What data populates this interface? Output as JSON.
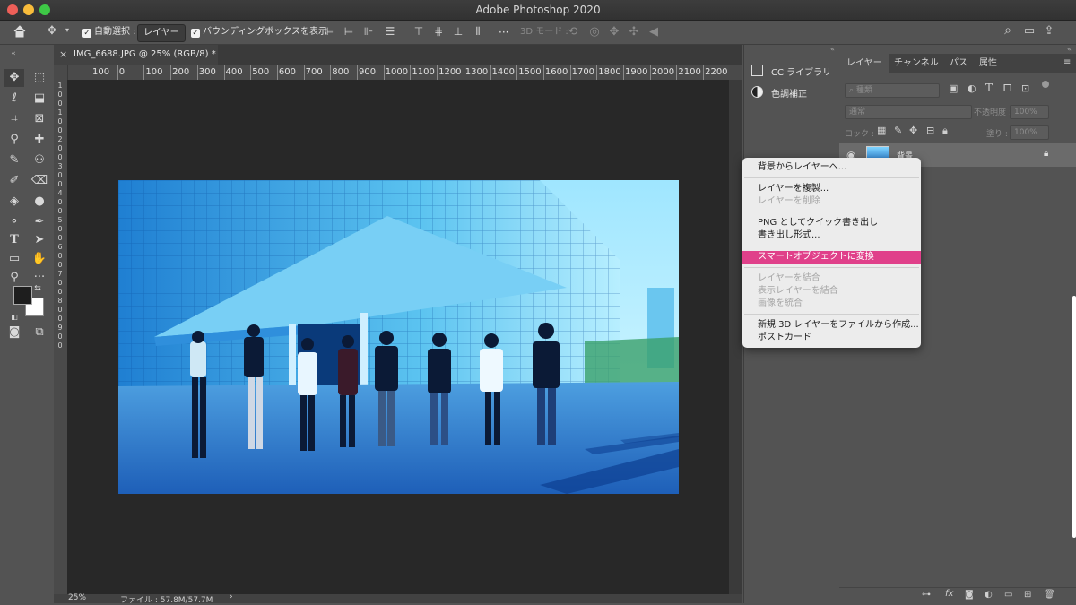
{
  "app": {
    "window_title": "Adobe Photoshop 2020"
  },
  "options_bar": {
    "auto_select_label": "自動選択 :",
    "auto_select_target": "レイヤー",
    "bounding_box_label": "バウンディングボックスを表示",
    "mode_3d_label": "3D モード :",
    "more_label": "···"
  },
  "document": {
    "tab_title": "IMG_6688.JPG @ 25% (RGB/8) *",
    "zoom": "25%",
    "file_info": "ファイル : 57.8M/57.7M",
    "status_arrow": "›",
    "ruler_h": [
      "100",
      "0",
      "100",
      "200",
      "300",
      "400",
      "500",
      "600",
      "700",
      "800",
      "900",
      "1000",
      "1100",
      "1200",
      "1300",
      "1400",
      "1500",
      "1600",
      "1700",
      "1800",
      "1900",
      "2000",
      "2100",
      "2200"
    ],
    "ruler_v": [
      "1",
      "0",
      "0",
      "1",
      "0",
      "0",
      "2",
      "0",
      "0",
      "3",
      "0",
      "0",
      "4",
      "0",
      "0",
      "5",
      "0",
      "0",
      "6",
      "0",
      "0",
      "7",
      "0",
      "0",
      "8",
      "0",
      "0",
      "9",
      "0",
      "0"
    ]
  },
  "mid_panel": {
    "items": [
      {
        "label": "CC ライブラリ",
        "icon": "cc-libraries-icon"
      },
      {
        "label": "色調補正",
        "icon": "adjustments-icon"
      }
    ]
  },
  "layers_panel": {
    "tabs": [
      "レイヤー",
      "チャンネル",
      "パス",
      "属性"
    ],
    "active_tab": "レイヤー",
    "search_placeholder": "種類",
    "blend_mode": "通常",
    "opacity_label": "不透明度 :",
    "opacity_value": "100%",
    "lock_label": "ロック :",
    "fill_label": "塗り :",
    "fill_value": "100%",
    "layers": [
      {
        "name": "背景",
        "locked": true,
        "visible": true
      }
    ],
    "footer_icons": [
      "link-icon",
      "fx-icon",
      "mask-icon",
      "adjustment-icon",
      "folder-icon",
      "new-layer-icon",
      "trash-icon"
    ]
  },
  "context_menu": {
    "groups": [
      [
        {
          "label": "背景からレイヤーへ...",
          "enabled": true
        }
      ],
      [
        {
          "label": "レイヤーを複製...",
          "enabled": true
        },
        {
          "label": "レイヤーを削除",
          "enabled": false
        }
      ],
      [
        {
          "label": "PNG としてクイック書き出し",
          "enabled": true
        },
        {
          "label": "書き出し形式...",
          "enabled": true
        }
      ],
      [
        {
          "label": "スマートオブジェクトに変換",
          "enabled": true,
          "highlighted": true
        }
      ],
      [
        {
          "label": "レイヤーを結合",
          "enabled": false
        },
        {
          "label": "表示レイヤーを結合",
          "enabled": false
        },
        {
          "label": "画像を統合",
          "enabled": false
        }
      ],
      [
        {
          "label": "新規 3D レイヤーをファイルから作成...",
          "enabled": true
        },
        {
          "label": "ポストカード",
          "enabled": true
        }
      ]
    ]
  },
  "colors": {
    "highlight": "#e0408a",
    "foreground": "#1e1e1e",
    "background": "#ffffff"
  }
}
